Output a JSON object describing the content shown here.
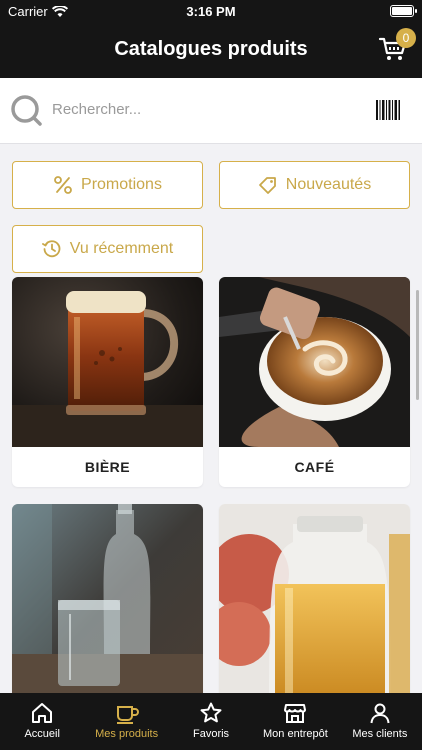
{
  "status": {
    "carrier": "Carrier",
    "time": "3:16 PM"
  },
  "header": {
    "title": "Catalogues produits",
    "cart_count": "0"
  },
  "search": {
    "placeholder": "Rechercher..."
  },
  "filters": {
    "promotions": "Promotions",
    "new": "Nouveautés",
    "recent": "Vu récemment"
  },
  "categories": [
    {
      "label": "BIÈRE"
    },
    {
      "label": "CAFÉ"
    }
  ],
  "tabs": [
    {
      "label": "Accueil",
      "icon": "home-icon"
    },
    {
      "label": "Mes produits",
      "icon": "cup-icon",
      "active": true
    },
    {
      "label": "Favoris",
      "icon": "star-icon"
    },
    {
      "label": "Mon entrepôt",
      "icon": "store-icon"
    },
    {
      "label": "Mes clients",
      "icon": "user-icon"
    }
  ],
  "colors": {
    "accent": "#d6b04a",
    "bars": "#151515",
    "background": "#f2f2f5"
  }
}
